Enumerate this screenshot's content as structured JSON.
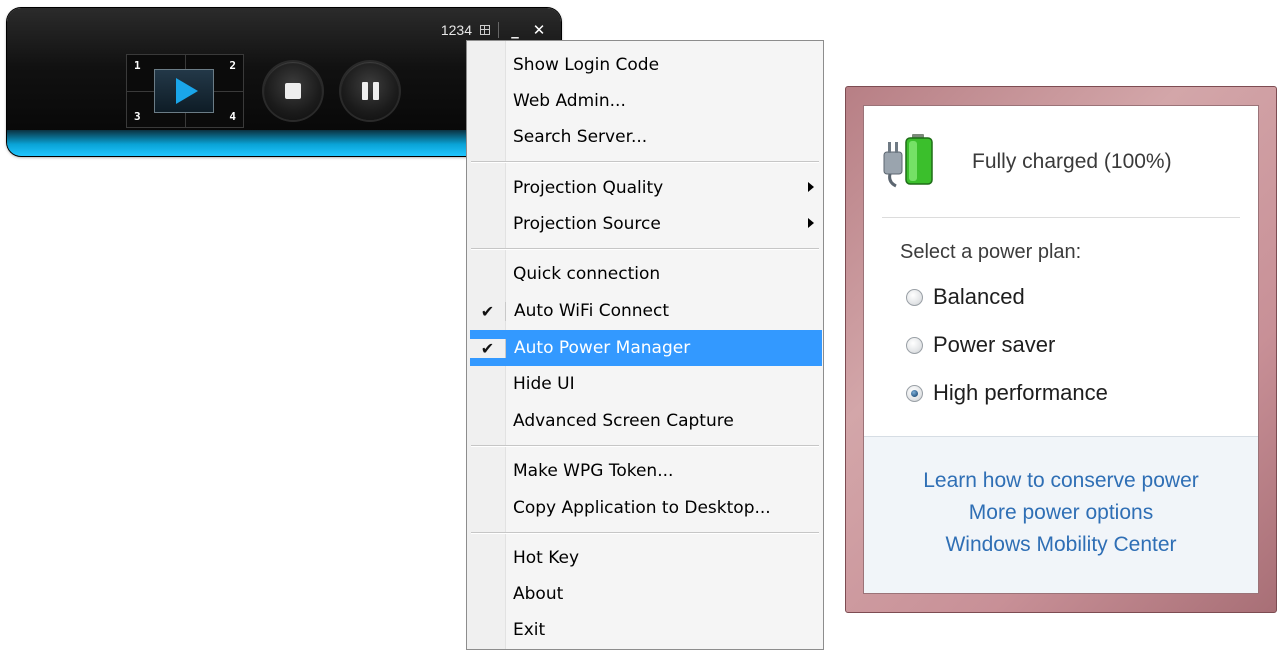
{
  "player": {
    "login_code": "1234",
    "quadrants": [
      "1",
      "2",
      "3",
      "4"
    ],
    "icons": {
      "grid": "grid-icon",
      "minimize": "minimize-icon",
      "close": "close-icon",
      "play": "play-icon",
      "stop": "stop-icon",
      "pause": "pause-icon"
    },
    "accent_color": "#1aa6ea"
  },
  "menu": {
    "items": [
      {
        "label": "Show Login Code"
      },
      {
        "label": "Web Admin..."
      },
      {
        "label": "Search Server..."
      },
      {
        "label": "Projection Quality",
        "submenu": true
      },
      {
        "label": "Projection Source",
        "submenu": true
      },
      {
        "label": "Quick connection"
      },
      {
        "label": "Auto WiFi Connect",
        "checked": true
      },
      {
        "label": "Auto Power Manager",
        "checked": true,
        "highlighted": true
      },
      {
        "label": "Hide UI"
      },
      {
        "label": "Advanced Screen Capture"
      },
      {
        "label": "Make WPG Token..."
      },
      {
        "label": "Copy Application to Desktop..."
      },
      {
        "label": "Hot Key"
      },
      {
        "label": "About"
      },
      {
        "label": "Exit"
      }
    ],
    "check_glyph": "✔",
    "highlight_color": "#3399ff"
  },
  "power": {
    "status": "Fully charged (100%)",
    "battery_icon": "battery-plug-icon",
    "plan_heading": "Select a power plan:",
    "plans": [
      {
        "label": "Balanced",
        "selected": false
      },
      {
        "label": "Power saver",
        "selected": false
      },
      {
        "label": "High performance",
        "selected": true
      }
    ],
    "links": [
      "Learn how to conserve power",
      "More power options",
      "Windows Mobility Center"
    ],
    "link_color": "#2f6fb5"
  }
}
